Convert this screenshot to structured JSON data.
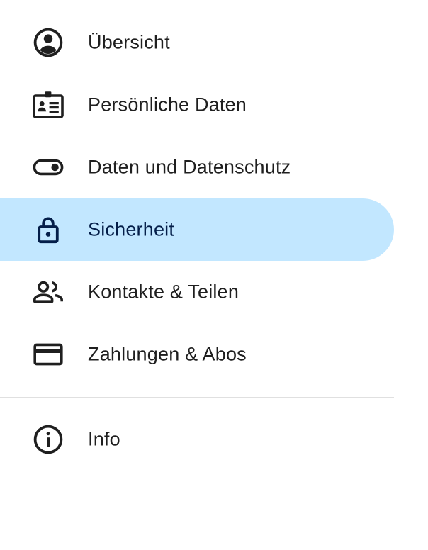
{
  "nav": {
    "items": [
      {
        "label": "Übersicht",
        "icon": "account-circle-icon"
      },
      {
        "label": "Persönliche Daten",
        "icon": "id-card-icon"
      },
      {
        "label": "Daten und Datenschutz",
        "icon": "toggle-icon"
      },
      {
        "label": "Sicherheit",
        "icon": "lock-icon",
        "active": true
      },
      {
        "label": "Kontakte & Teilen",
        "icon": "people-icon"
      },
      {
        "label": "Zahlungen & Abos",
        "icon": "credit-card-icon"
      }
    ],
    "info": {
      "label": "Info",
      "icon": "info-icon"
    }
  },
  "colors": {
    "active_background": "#c2e7ff",
    "active_text": "#041e49",
    "text": "#1f1f1f",
    "divider": "#e0e0e0"
  }
}
